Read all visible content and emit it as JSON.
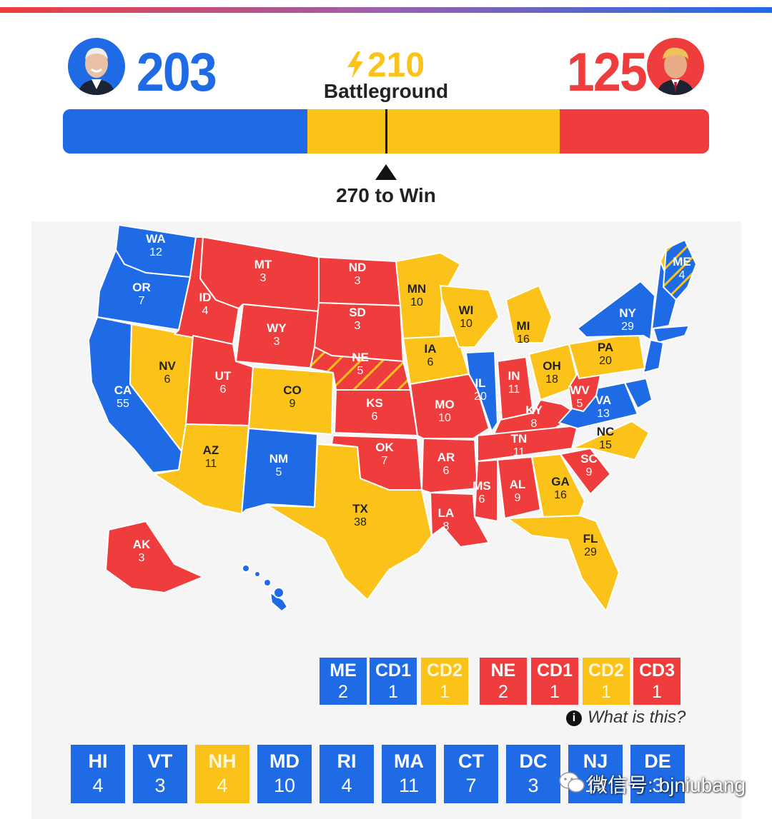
{
  "colors": {
    "dem": "#1e6be5",
    "rep": "#ef3d3d",
    "toss": "#fbc319",
    "panel": "#f4f5f4"
  },
  "header": {
    "dem_votes": "203",
    "rep_votes": "125",
    "battleground_votes": "210",
    "battleground_label": "Battleground",
    "win_label": "270 to Win"
  },
  "states": [
    {
      "abbr": "WA",
      "ev": "12",
      "party": "dem"
    },
    {
      "abbr": "OR",
      "ev": "7",
      "party": "dem"
    },
    {
      "abbr": "CA",
      "ev": "55",
      "party": "dem"
    },
    {
      "abbr": "NV",
      "ev": "6",
      "party": "toss"
    },
    {
      "abbr": "ID",
      "ev": "4",
      "party": "rep"
    },
    {
      "abbr": "MT",
      "ev": "3",
      "party": "rep"
    },
    {
      "abbr": "WY",
      "ev": "3",
      "party": "rep"
    },
    {
      "abbr": "UT",
      "ev": "6",
      "party": "rep"
    },
    {
      "abbr": "AZ",
      "ev": "11",
      "party": "toss"
    },
    {
      "abbr": "CO",
      "ev": "9",
      "party": "toss"
    },
    {
      "abbr": "NM",
      "ev": "5",
      "party": "dem"
    },
    {
      "abbr": "ND",
      "ev": "3",
      "party": "rep"
    },
    {
      "abbr": "SD",
      "ev": "3",
      "party": "rep"
    },
    {
      "abbr": "NE",
      "ev": "5",
      "party": "rep"
    },
    {
      "abbr": "KS",
      "ev": "6",
      "party": "rep"
    },
    {
      "abbr": "OK",
      "ev": "7",
      "party": "rep"
    },
    {
      "abbr": "TX",
      "ev": "38",
      "party": "toss"
    },
    {
      "abbr": "MN",
      "ev": "10",
      "party": "toss"
    },
    {
      "abbr": "IA",
      "ev": "6",
      "party": "toss"
    },
    {
      "abbr": "MO",
      "ev": "10",
      "party": "rep"
    },
    {
      "abbr": "AR",
      "ev": "6",
      "party": "rep"
    },
    {
      "abbr": "LA",
      "ev": "8",
      "party": "rep"
    },
    {
      "abbr": "WI",
      "ev": "10",
      "party": "toss"
    },
    {
      "abbr": "IL",
      "ev": "20",
      "party": "dem"
    },
    {
      "abbr": "MI",
      "ev": "16",
      "party": "toss"
    },
    {
      "abbr": "IN",
      "ev": "11",
      "party": "rep"
    },
    {
      "abbr": "OH",
      "ev": "18",
      "party": "toss"
    },
    {
      "abbr": "KY",
      "ev": "8",
      "party": "rep"
    },
    {
      "abbr": "TN",
      "ev": "11",
      "party": "rep"
    },
    {
      "abbr": "MS",
      "ev": "6",
      "party": "rep"
    },
    {
      "abbr": "AL",
      "ev": "9",
      "party": "rep"
    },
    {
      "abbr": "GA",
      "ev": "16",
      "party": "toss"
    },
    {
      "abbr": "FL",
      "ev": "29",
      "party": "toss"
    },
    {
      "abbr": "SC",
      "ev": "9",
      "party": "rep"
    },
    {
      "abbr": "NC",
      "ev": "15",
      "party": "toss"
    },
    {
      "abbr": "VA",
      "ev": "13",
      "party": "dem"
    },
    {
      "abbr": "WV",
      "ev": "5",
      "party": "rep"
    },
    {
      "abbr": "PA",
      "ev": "20",
      "party": "toss"
    },
    {
      "abbr": "NY",
      "ev": "29",
      "party": "dem"
    },
    {
      "abbr": "ME",
      "ev": "4",
      "party": "dem"
    },
    {
      "abbr": "AK",
      "ev": "3",
      "party": "rep"
    },
    {
      "abbr": "HI",
      "ev": "4",
      "party": "dem"
    }
  ],
  "split_states": [
    {
      "label": "ME",
      "ev": "2",
      "party": "dem"
    },
    {
      "label": "CD1",
      "ev": "1",
      "party": "dem"
    },
    {
      "label": "CD2",
      "ev": "1",
      "party": "toss"
    },
    {
      "label": "NE",
      "ev": "2",
      "party": "rep"
    },
    {
      "label": "CD1",
      "ev": "1",
      "party": "rep"
    },
    {
      "label": "CD2",
      "ev": "1",
      "party": "toss"
    },
    {
      "label": "CD3",
      "ev": "1",
      "party": "rep"
    }
  ],
  "what_is_this": "What is this?",
  "small_states": [
    {
      "abbr": "HI",
      "ev": "4",
      "party": "dem"
    },
    {
      "abbr": "VT",
      "ev": "3",
      "party": "dem"
    },
    {
      "abbr": "NH",
      "ev": "4",
      "party": "toss"
    },
    {
      "abbr": "MD",
      "ev": "10",
      "party": "dem"
    },
    {
      "abbr": "RI",
      "ev": "4",
      "party": "dem"
    },
    {
      "abbr": "MA",
      "ev": "11",
      "party": "dem"
    },
    {
      "abbr": "CT",
      "ev": "7",
      "party": "dem"
    },
    {
      "abbr": "DC",
      "ev": "3",
      "party": "dem"
    },
    {
      "abbr": "NJ",
      "ev": "14",
      "party": "dem"
    },
    {
      "abbr": "DE",
      "ev": "3",
      "party": "dem"
    }
  ],
  "watermark": "微信号: bjniubang"
}
